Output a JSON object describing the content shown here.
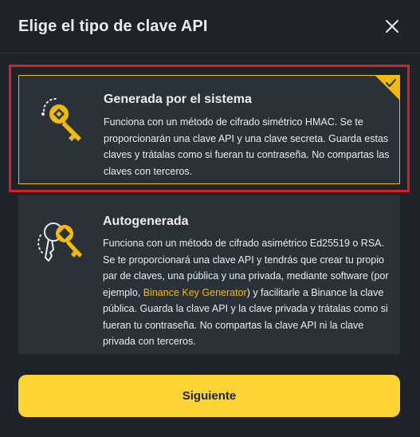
{
  "dialog": {
    "title": "Elige el tipo de clave API"
  },
  "options": [
    {
      "title": "Generada por el sistema",
      "description": "Funciona con un método de cifrado simétrico HMAC. Se te proporcionarán una clave API y una clave secreta. Guarda estas claves y trátalas como si fueran tu contraseña. No compartas las claves con terceros.",
      "selected": true,
      "icon": "key-icon"
    },
    {
      "title": "Autogenerada",
      "description_before": "Funciona con un método de cifrado asimétrico Ed25519 o RSA. Se te proporcionará una clave API y tendrás que crear tu propio par de claves, una pública y una privada, mediante software (por ejemplo, ",
      "link_text": "Binance Key Generator",
      "description_after": ") y facilitarle a Binance la clave pública. Guarda la clave API y la clave privada y trátalas como si fueran tu contraseña. No compartas la clave API ni la clave privada con terceros.",
      "selected": false,
      "icon": "key-pair-icon"
    }
  ],
  "footer": {
    "next_label": "Siguiente"
  },
  "colors": {
    "background": "#1e2329",
    "card": "#2b3139",
    "accent": "#f0b90b",
    "button": "#fcd535",
    "highlight": "#d0222a"
  }
}
